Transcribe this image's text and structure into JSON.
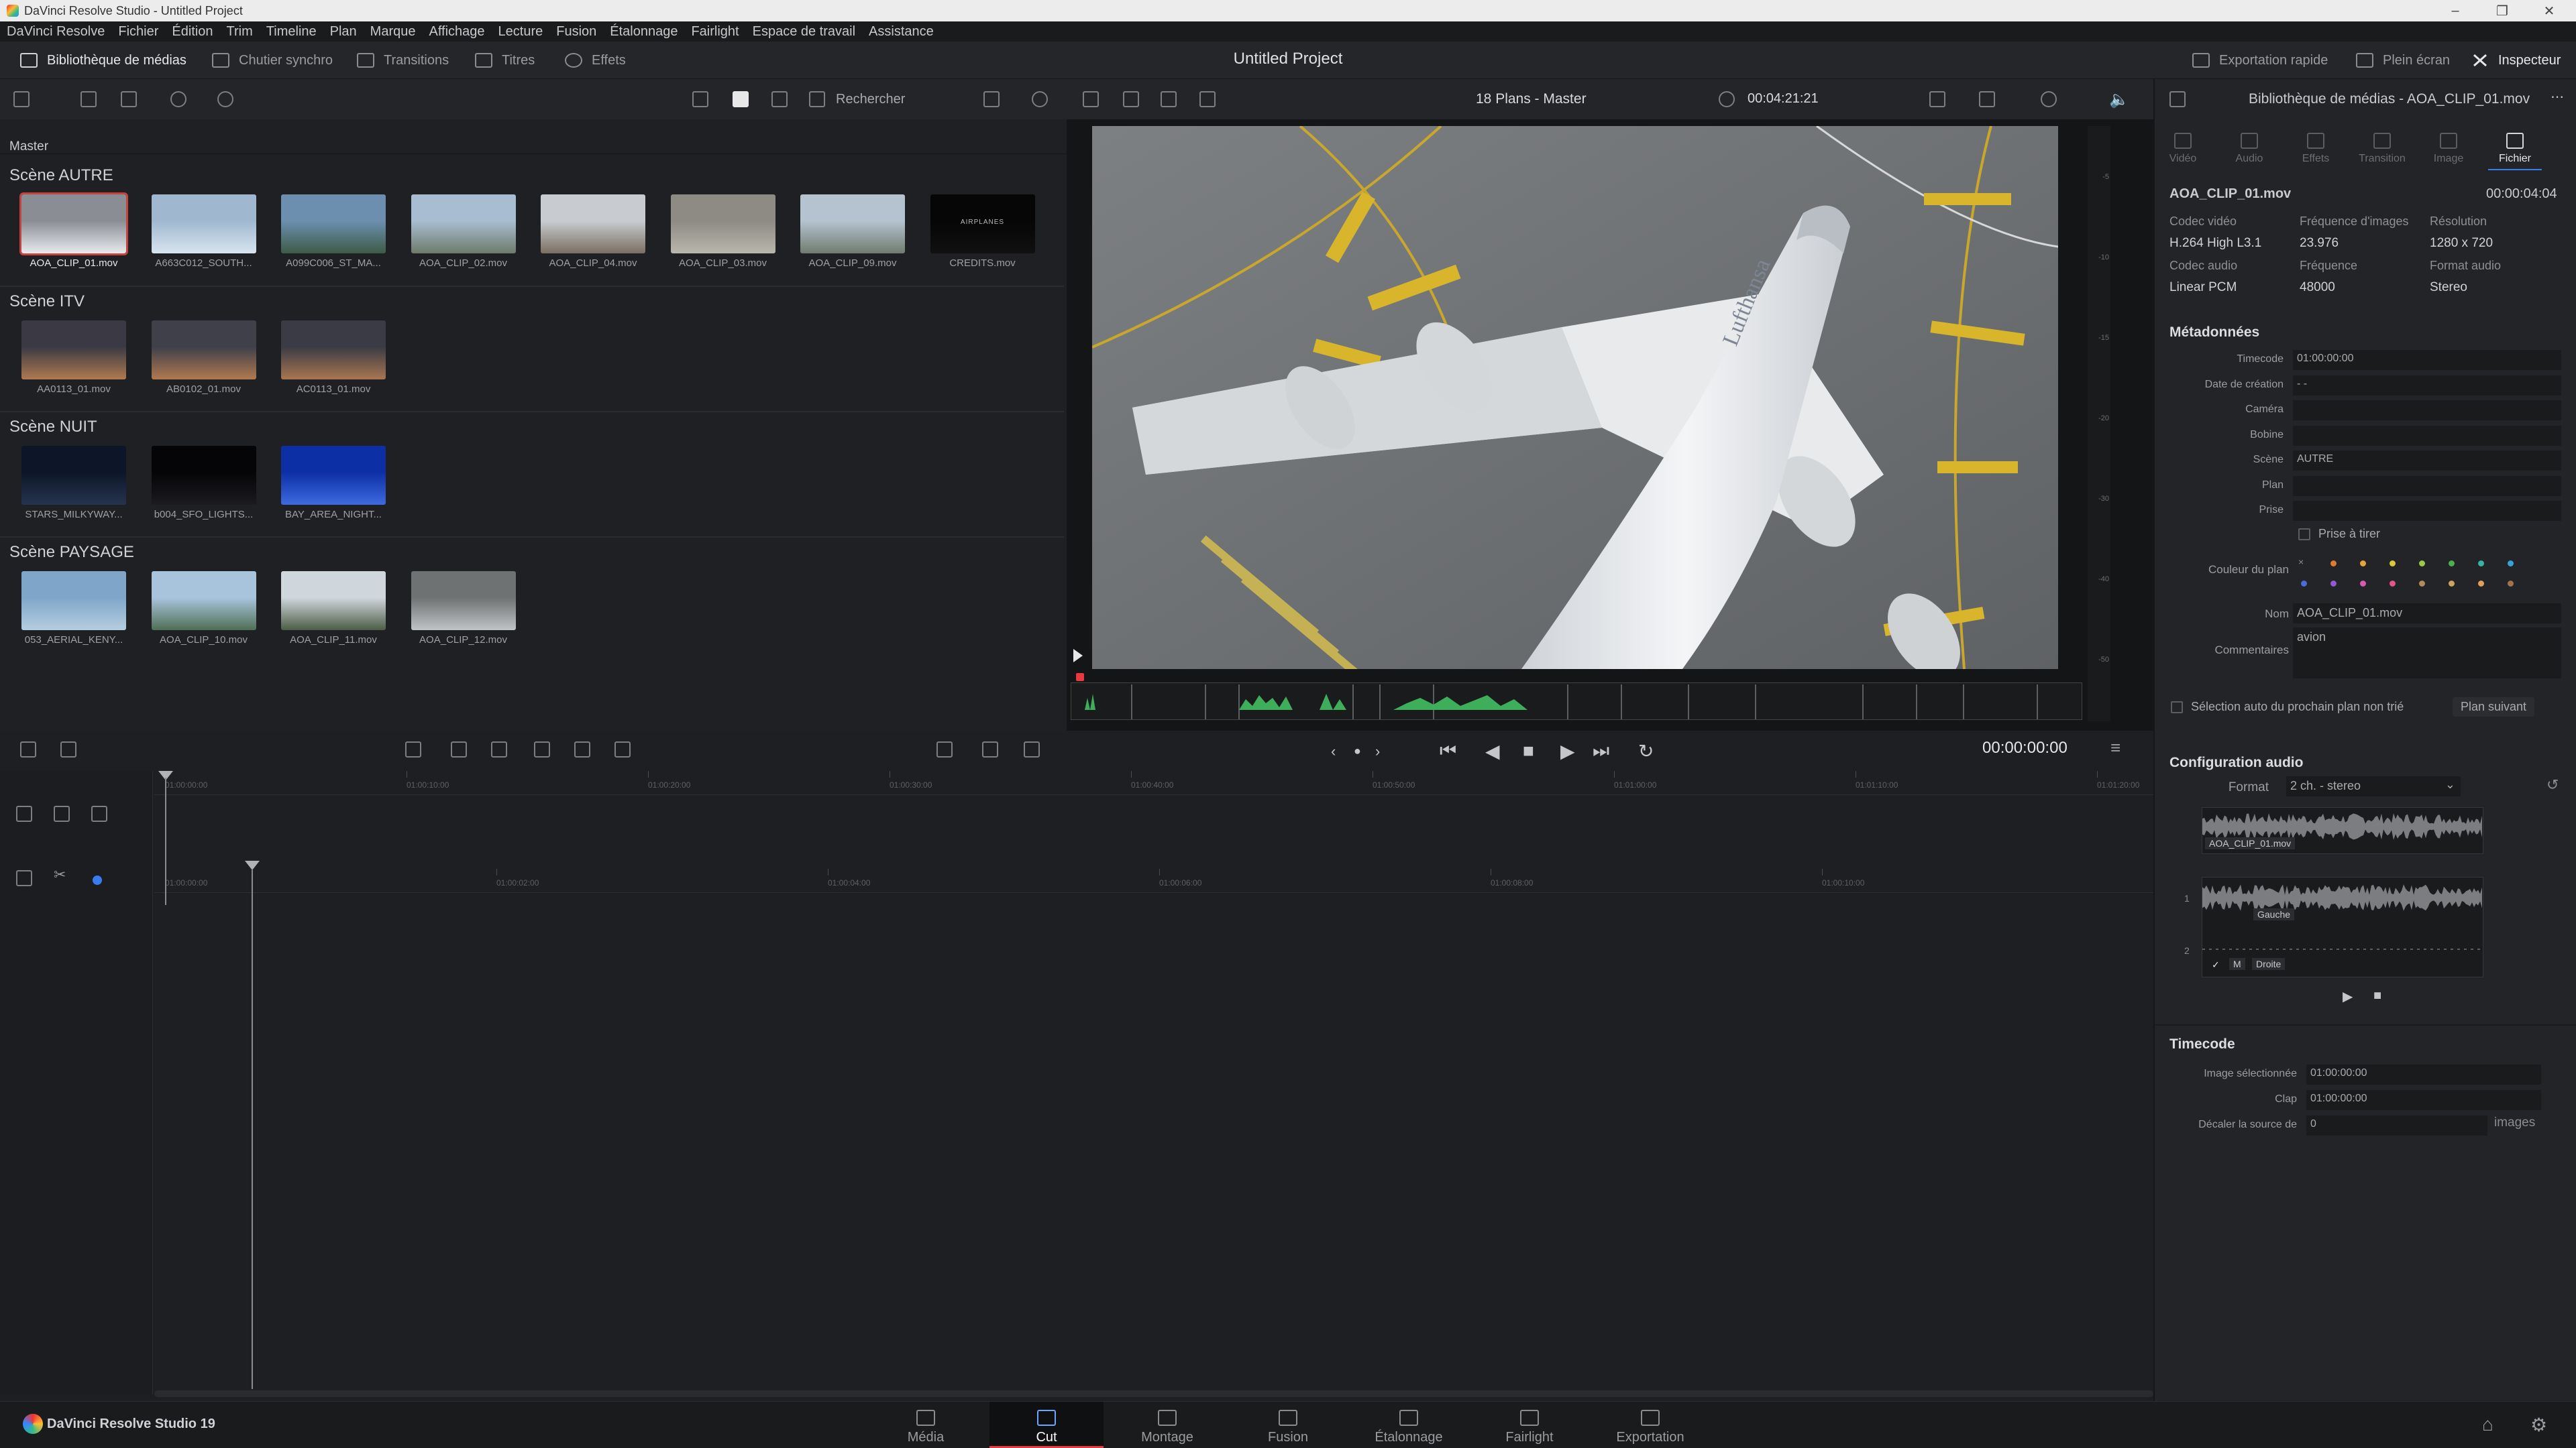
{
  "window": {
    "title": "DaVinci Resolve Studio - Untitled Project"
  },
  "menu": [
    "DaVinci Resolve",
    "Fichier",
    "Édition",
    "Trim",
    "Timeline",
    "Plan",
    "Marque",
    "Affichage",
    "Lecture",
    "Fusion",
    "Étalonnage",
    "Fairlight",
    "Espace de travail",
    "Assistance"
  ],
  "module_bar": {
    "media_pool": "Bibliothèque de médias",
    "sync_bin": "Chutier synchro",
    "transitions": "Transitions",
    "titles": "Titres",
    "effects": "Effets",
    "project_title": "Untitled Project",
    "quick_export": "Exportation rapide",
    "fullscreen": "Plein écran",
    "inspector": "Inspecteur"
  },
  "media_pool": {
    "search_placeholder": "Rechercher",
    "bin": "Master",
    "scenes": [
      {
        "title": "Scène AUTRE",
        "clips": [
          {
            "name": "AOA_CLIP_01.mov",
            "colors": [
              "#8a8e94",
              "#e8eaed"
            ],
            "selected": true
          },
          {
            "name": "A663C012_SOUTH...",
            "colors": [
              "#9fb8d0",
              "#d9e4ee"
            ],
            "selected": false
          },
          {
            "name": "A099C006_ST_MA...",
            "colors": [
              "#6c8fb0",
              "#3d5b46"
            ],
            "selected": false
          },
          {
            "name": "AOA_CLIP_02.mov",
            "colors": [
              "#a9bdd2",
              "#6d7a6a"
            ],
            "selected": false
          },
          {
            "name": "AOA_CLIP_04.mov",
            "colors": [
              "#c8ccd0",
              "#7a6e62"
            ],
            "selected": false
          },
          {
            "name": "AOA_CLIP_03.mov",
            "colors": [
              "#8d8b83",
              "#b9b6ad"
            ],
            "selected": false
          },
          {
            "name": "AOA_CLIP_09.mov",
            "colors": [
              "#b4c3cf",
              "#717b6f"
            ],
            "selected": false
          },
          {
            "name": "CREDITS.mov",
            "colors": [
              "#060606",
              "#101010"
            ],
            "selected": false,
            "overlay": "AIRPLANES"
          }
        ]
      },
      {
        "title": "Scène ITV",
        "clips": [
          {
            "name": "AA0113_01.mov",
            "colors": [
              "#3b3a44",
              "#b07a4f"
            ],
            "selected": false
          },
          {
            "name": "AB0102_01.mov",
            "colors": [
              "#40404b",
              "#b0794f"
            ],
            "selected": false
          },
          {
            "name": "AC0113_01.mov",
            "colors": [
              "#3b3b45",
              "#a87650"
            ],
            "selected": false
          }
        ]
      },
      {
        "title": "Scène NUIT",
        "clips": [
          {
            "name": "STARS_MILKYWAY...",
            "colors": [
              "#0d1628",
              "#27344f"
            ],
            "selected": false
          },
          {
            "name": "b004_SFO_LIGHTS...",
            "colors": [
              "#050507",
              "#1b1b20"
            ],
            "selected": false
          },
          {
            "name": "BAY_AREA_NIGHT...",
            "colors": [
              "#0d2fa5",
              "#3e6ae0"
            ],
            "selected": false
          }
        ]
      },
      {
        "title": "Scène PAYSAGE",
        "clips": [
          {
            "name": "053_AERIAL_KENY...",
            "colors": [
              "#7fa6c9",
              "#b5cde0"
            ],
            "selected": false
          },
          {
            "name": "AOA_CLIP_10.mov",
            "colors": [
              "#a8c4dc",
              "#4f6e55"
            ],
            "selected": false
          },
          {
            "name": "AOA_CLIP_11.mov",
            "colors": [
              "#cfd6dc",
              "#4c5d46"
            ],
            "selected": false
          },
          {
            "name": "AOA_CLIP_12.mov",
            "colors": [
              "#6f7272",
              "#c0c4c7"
            ],
            "selected": false
          }
        ]
      }
    ]
  },
  "viewer": {
    "title": "18 Plans - Master",
    "duration": "00:04:21:21",
    "timecode": "00:00:00:00",
    "meter_ticks": [
      "-5",
      "-10",
      "-15",
      "-20",
      "-30",
      "-40",
      "-50"
    ]
  },
  "timeline": {
    "ruler_top": [
      "01:00:00:00",
      "01:00:10:00",
      "01:00:20:00",
      "01:00:30:00",
      "01:00:40:00",
      "01:00:50:00",
      "01:01:00:00",
      "01:01:10:00",
      "01:01:20:00"
    ],
    "ruler_bottom": [
      "01:00:00:00",
      "01:00:02:00",
      "01:00:04:00",
      "01:00:06:00",
      "01:00:08:00",
      "01:00:10:00"
    ]
  },
  "inspector": {
    "header": "Bibliothèque de médias - AOA_CLIP_01.mov",
    "tabs": [
      "Vidéo",
      "Audio",
      "Effets",
      "Transition",
      "Image",
      "Fichier"
    ],
    "active_tab": "Fichier",
    "clip_name": "AOA_CLIP_01.mov",
    "clip_duration": "00:00:04:04",
    "props": [
      {
        "label": "Codec vidéo",
        "value": "H.264 High L3.1"
      },
      {
        "label": "Fréquence d'images",
        "value": "23.976"
      },
      {
        "label": "Résolution",
        "value": "1280 x 720"
      },
      {
        "label": "Codec audio",
        "value": "Linear PCM"
      },
      {
        "label": "Fréquence",
        "value": "48000"
      },
      {
        "label": "Format audio",
        "value": "Stereo"
      }
    ],
    "metadata_title": "Métadonnées",
    "metadata": [
      {
        "label": "Timecode",
        "value": "01:00:00:00"
      },
      {
        "label": "Date de création",
        "value": "- -"
      },
      {
        "label": "Caméra",
        "value": ""
      },
      {
        "label": "Bobine",
        "value": ""
      },
      {
        "label": "Scène",
        "value": "AUTRE"
      },
      {
        "label": "Plan",
        "value": ""
      },
      {
        "label": "Prise",
        "value": ""
      }
    ],
    "circle_take": "Prise à tirer",
    "clip_color_label": "Couleur du plan",
    "clip_colors_row1": [
      "#e07a2e",
      "#e5a53b",
      "#d9c93a",
      "#9ec84a",
      "#4caf50",
      "#37b3a3",
      "#3aa0d8"
    ],
    "clip_colors_row2": [
      "#4a6cd6",
      "#8e5bd1",
      "#d45bb0",
      "#e0568a",
      "#b38a5c",
      "#cfa25e",
      "#e0a05a",
      "#a0754d"
    ],
    "name_label": "Nom",
    "name_value": "AOA_CLIP_01.mov",
    "comments_label": "Commentaires",
    "comments_value": "avion",
    "auto_select": "Sélection auto du prochain plan non trié",
    "next_clip": "Plan suivant",
    "audio_title": "Configuration audio",
    "format_label": "Format",
    "format_value": "2 ch. - stereo",
    "wave_label_main": "AOA_CLIP_01.mov",
    "wave_label_left": "Gauche",
    "wave_label_right": "Droite",
    "channel_1": "1",
    "channel_2": "2",
    "mute_label": "M",
    "timecode_title": "Timecode",
    "tc_rows": [
      {
        "label": "Image sélectionnée",
        "value": "01:00:00:00"
      },
      {
        "label": "Clap",
        "value": "01:00:00:00"
      },
      {
        "label": "Décaler la source de",
        "value": "0"
      }
    ],
    "frames_unit": "images"
  },
  "pages": [
    "Média",
    "Cut",
    "Montage",
    "Fusion",
    "Étalonnage",
    "Fairlight",
    "Exportation"
  ],
  "active_page": "Cut",
  "brand": "DaVinci Resolve Studio 19"
}
